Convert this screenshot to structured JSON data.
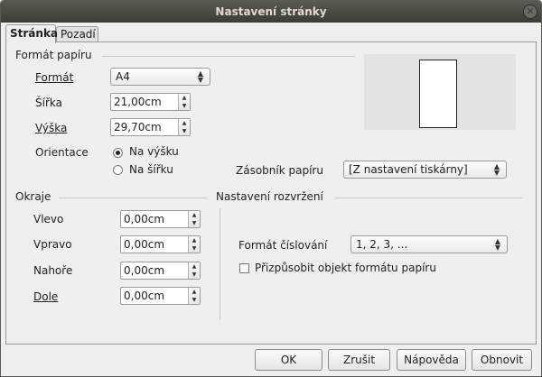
{
  "title": "Nastavení stránky",
  "tabs": {
    "page": "Stránka",
    "background": "Pozadí"
  },
  "paper_format": {
    "section": "Formát papíru",
    "format_label": "Formát",
    "format_value": "A4",
    "width_label": "Šířka",
    "width_value": "21,00cm",
    "height_label": "Výška",
    "height_value": "29,70cm",
    "orientation_label": "Orientace",
    "portrait": "Na výšku",
    "landscape": "Na šířku",
    "tray_label": "Zásobník papíru",
    "tray_value": "[Z nastavení tiskárny]"
  },
  "margins": {
    "section": "Okraje",
    "left_label": "Vlevo",
    "left_value": "0,00cm",
    "right_label": "Vpravo",
    "right_value": "0,00cm",
    "top_label": "Nahoře",
    "top_value": "0,00cm",
    "bottom_label": "Dole",
    "bottom_value": "0,00cm"
  },
  "layout": {
    "section": "Nastavení rozvržení",
    "numbering_label": "Formát číslování",
    "numbering_value": "1, 2, 3, ...",
    "fit_label": "Přizpůsobit objekt formátu papíru"
  },
  "buttons": {
    "ok": "OK",
    "cancel": "Zrušit",
    "help": "Nápověda",
    "reset": "Obnovit"
  }
}
